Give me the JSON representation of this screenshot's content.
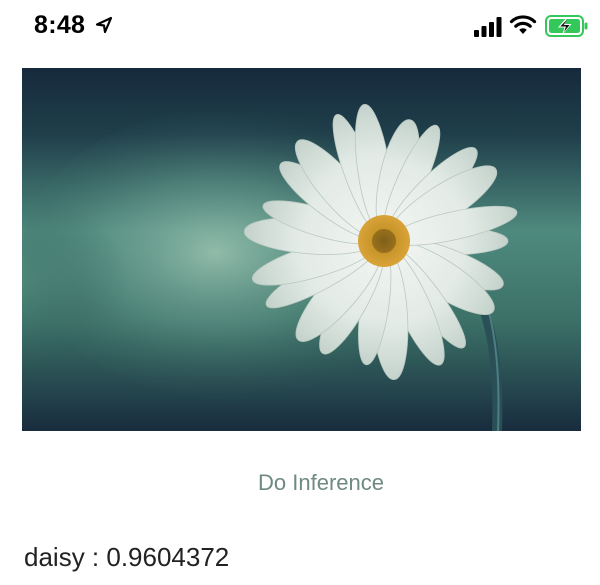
{
  "status_bar": {
    "time": "8:48",
    "icons": [
      "location-arrow-icon",
      "cellular-signal-icon",
      "wifi-icon",
      "battery-charging-icon"
    ],
    "battery_color": "#34c759"
  },
  "image": {
    "subject_icon": "daisy-flower-image"
  },
  "inference_button": {
    "label": "Do Inference",
    "color": "#6f8a82"
  },
  "result": {
    "text": "daisy : 0.9604372"
  }
}
